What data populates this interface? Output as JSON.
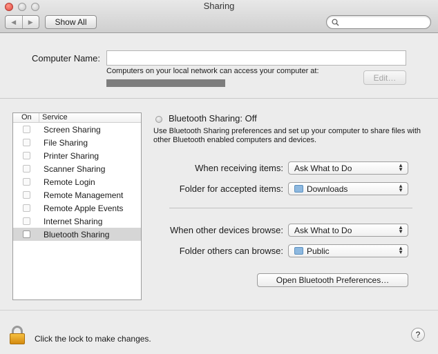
{
  "window": {
    "title": "Sharing",
    "show_all": "Show All",
    "back_glyph": "◀",
    "forward_glyph": "▶",
    "search_placeholder": "",
    "search_icon": "search-icon"
  },
  "computer": {
    "label": "Computer Name:",
    "value": "",
    "note": "Computers on your local network can access your computer at:",
    "edit_label": "Edit…"
  },
  "services": {
    "header_on": "On",
    "header_service": "Service",
    "items": [
      {
        "label": "Screen Sharing",
        "checked": false
      },
      {
        "label": "File Sharing",
        "checked": false
      },
      {
        "label": "Printer Sharing",
        "checked": false
      },
      {
        "label": "Scanner Sharing",
        "checked": false
      },
      {
        "label": "Remote Login",
        "checked": false
      },
      {
        "label": "Remote Management",
        "checked": false
      },
      {
        "label": "Remote Apple Events",
        "checked": false
      },
      {
        "label": "Internet Sharing",
        "checked": false
      },
      {
        "label": "Bluetooth Sharing",
        "checked": false
      }
    ],
    "selected": "Bluetooth Sharing"
  },
  "detail": {
    "status": "Bluetooth Sharing: Off",
    "description": "Use Bluetooth Sharing preferences and set up your computer to share files with other Bluetooth enabled computers and devices.",
    "receiving_label": "When receiving items:",
    "receiving_value": "Ask What to Do",
    "accepted_label": "Folder for accepted items:",
    "accepted_value": "Downloads",
    "browse_label": "When other devices browse:",
    "browse_value": "Ask What to Do",
    "browse_folder_label": "Folder others can browse:",
    "browse_folder_value": "Public",
    "open_prefs_label": "Open Bluetooth Preferences…"
  },
  "footer": {
    "lock_text": "Click the lock to make changes.",
    "help_glyph": "?"
  }
}
